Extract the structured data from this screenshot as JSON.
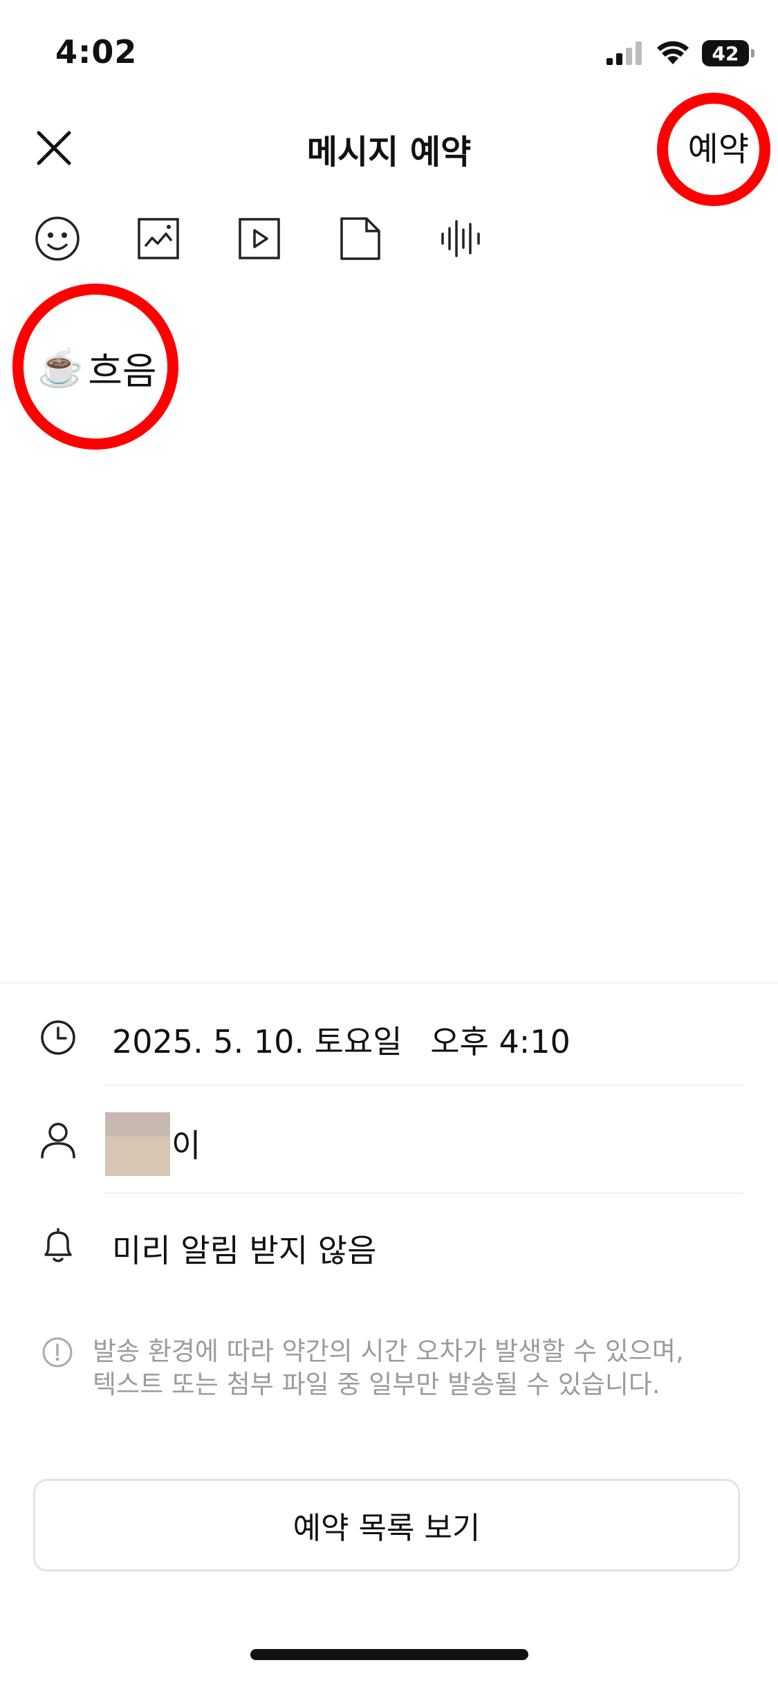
{
  "status_bar": {
    "time": "4:02",
    "battery_level": "42",
    "icons": [
      "cellular-signal-icon",
      "wifi-icon",
      "battery-icon"
    ]
  },
  "header": {
    "title": "메시지 예약",
    "reserve_label": "예약",
    "close_icon": "close-icon"
  },
  "toolbar": {
    "items": [
      "emoji-icon",
      "photo-icon",
      "video-icon",
      "file-icon",
      "voice-icon"
    ]
  },
  "message": {
    "emoji": "☕️",
    "text": "흐음"
  },
  "schedule": {
    "date": "2025. 5. 10. 토요일",
    "time": "오후 4:10"
  },
  "recipient": {
    "name": "이"
  },
  "alert": {
    "label": "미리 알림 받지 않음"
  },
  "notice": {
    "line1": "발송 환경에 따라 약간의 시간 오차가 발생할 수 있으며,",
    "line2": "텍스트 또는 첨부 파일 중 일부만 발송될 수 있습니다."
  },
  "footer": {
    "list_button": "예약 목록 보기"
  },
  "colors": {
    "highlight": "#ff0000",
    "notice_text": "#9b9b9b",
    "border": "#e3e3e3"
  }
}
